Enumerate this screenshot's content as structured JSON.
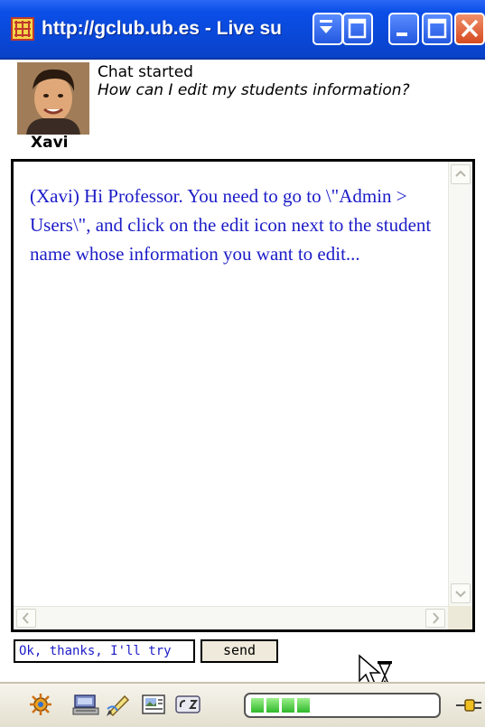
{
  "window": {
    "title": "http://gclub.ub.es - Live su",
    "accent_color": "#0b4fe8"
  },
  "header": {
    "agent_name": "Xavi",
    "status": "Chat started",
    "question": "How can I edit my students information?"
  },
  "chat": {
    "message": "(Xavi) Hi Professor. You need to go to \\\"Admin > Users\\\", and click on the edit icon next to the student name whose information you want to edit...",
    "text_color": "#1c1cc8"
  },
  "composer": {
    "input_value": "Ok, thanks, I'll try",
    "send_label": "send"
  },
  "toolbar": {
    "icons": [
      "settings-icon",
      "keyboard-icon",
      "edit-icon",
      "picture-icon",
      "spellcheck-icon"
    ],
    "progress_fraction": 0.33
  }
}
